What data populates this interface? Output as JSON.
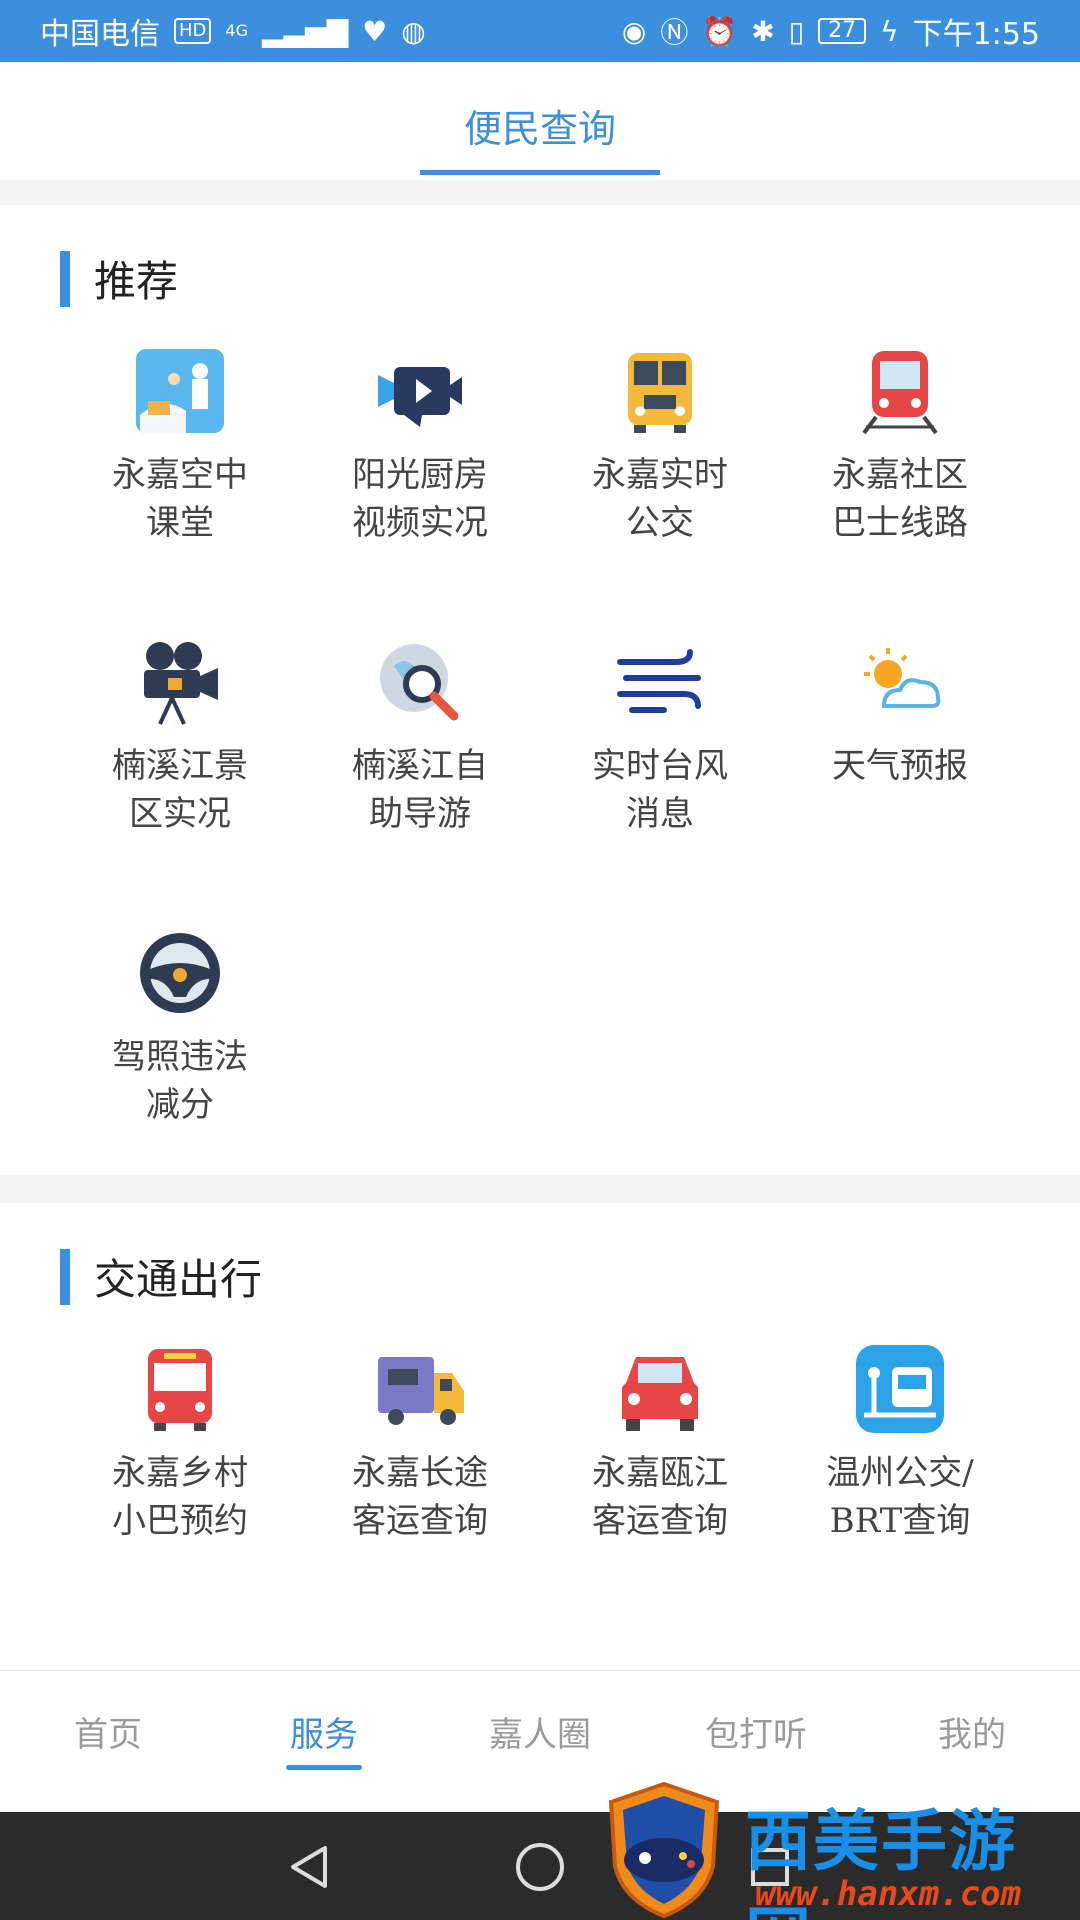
{
  "status_bar": {
    "carrier": "中国电信",
    "hd_badge": "HD",
    "network": "4G",
    "battery": "27",
    "time": "下午1:55"
  },
  "header": {
    "title": "便民查询"
  },
  "sections": [
    {
      "title": "推荐",
      "items": [
        {
          "label": "永嘉空中\n课堂",
          "icon": "classroom-icon"
        },
        {
          "label": "阳光厨房\n视频实况",
          "icon": "video-camera-icon"
        },
        {
          "label": "永嘉实时\n公交",
          "icon": "bus-icon"
        },
        {
          "label": "永嘉社区\n巴士线路",
          "icon": "train-icon"
        },
        {
          "label": "楠溪江景\n区实况",
          "icon": "movie-camera-icon"
        },
        {
          "label": "楠溪江自\n助导游",
          "icon": "globe-search-icon"
        },
        {
          "label": "实时台风\n消息",
          "icon": "wind-icon"
        },
        {
          "label": "天气预报",
          "icon": "weather-icon"
        },
        {
          "label": "驾照违法\n减分",
          "icon": "steering-wheel-icon"
        }
      ]
    },
    {
      "title": "交通出行",
      "items": [
        {
          "label": "永嘉乡村\n小巴预约",
          "icon": "red-bus-icon"
        },
        {
          "label": "永嘉长途\n客运查询",
          "icon": "truck-icon"
        },
        {
          "label": "永嘉瓯江\n客运查询",
          "icon": "car-icon"
        },
        {
          "label": "温州公交/\nBRT查询",
          "icon": "bus-stop-icon"
        }
      ]
    }
  ],
  "bottom_nav": [
    {
      "label": "首页",
      "active": false
    },
    {
      "label": "服务",
      "active": true
    },
    {
      "label": "嘉人圈",
      "active": false
    },
    {
      "label": "包打听",
      "active": false
    },
    {
      "label": "我的",
      "active": false
    }
  ],
  "watermark": {
    "name": "西美手游网",
    "url": "www.hanxm.com"
  },
  "colors": {
    "accent": "#3b8fdc",
    "status_bar": "#3b8fdc",
    "system_nav": "#2b2b2b"
  }
}
